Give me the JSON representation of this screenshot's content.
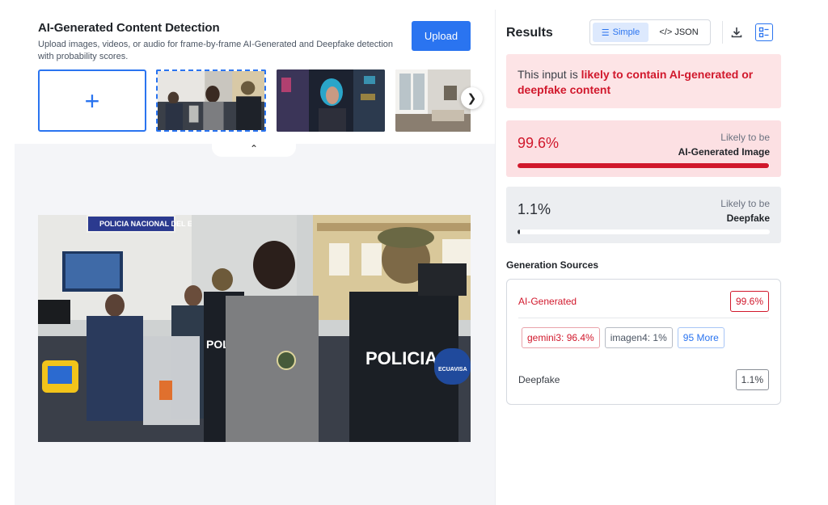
{
  "header": {
    "title": "AI-Generated Content Detection",
    "subtitle": "Upload images, videos, or audio for frame-by-frame AI-Generated and Deepfake detection with probability scores.",
    "upload_label": "Upload"
  },
  "gallery": {
    "add_icon": "plus-icon",
    "next_icon": "chevron-right-icon",
    "collapse_icon": "chevron-up-icon",
    "selected_index": 0
  },
  "results": {
    "title": "Results",
    "view_simple": "Simple",
    "view_json": "</> JSON",
    "active_view": "Simple",
    "verdict_prefix": "This input is ",
    "verdict_highlight": "likely to contain AI-generated or deepfake content",
    "scores": [
      {
        "pct": "99.6%",
        "value": 0.996,
        "likely": "Likely to be",
        "label": "AI-Generated Image"
      },
      {
        "pct": "1.1%",
        "value": 0.011,
        "likely": "Likely to be",
        "label": "Deepfake"
      }
    ],
    "sources_title": "Generation Sources",
    "sources": {
      "ai_label": "AI-Generated",
      "ai_pct": "99.6%",
      "chips": [
        "gemini3: 96.4%",
        "imagen4: 1%",
        "95 More"
      ],
      "df_label": "Deepfake",
      "df_pct": "1.1%"
    }
  },
  "colors": {
    "accent": "#2a74f0",
    "danger": "#d1182c",
    "danger_bg": "#fde4e6",
    "neutral_bg": "#eceef1"
  },
  "main_image": {
    "visible_texts": [
      "POLICIA",
      "POLICIA NACIONAL DEL ECUADOR",
      "ECUAVISA"
    ]
  }
}
